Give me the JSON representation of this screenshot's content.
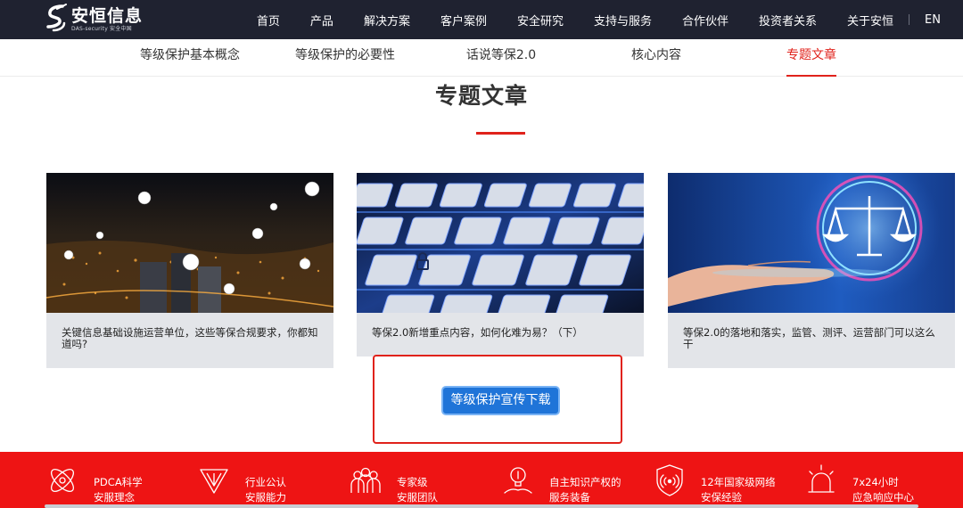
{
  "header": {
    "logo_cn": "安恒信息",
    "logo_en": "DAS-security 安全中国",
    "nav": [
      "首页",
      "产品",
      "解决方案",
      "客户案例",
      "安全研究",
      "支持与服务",
      "合作伙伴",
      "投资者关系",
      "关于安恒"
    ],
    "lang": "EN"
  },
  "subnav": {
    "items": [
      "等级保护基本概念",
      "等级保护的必要性",
      "话说等保2.0",
      "核心内容",
      "专题文章"
    ],
    "active_index": 4
  },
  "section": {
    "title": "专题文章"
  },
  "cards": [
    {
      "image": "smart-city-night-illustration",
      "text": "关键信息基础设施运营单位，这些等保合规要求，你都知道吗?"
    },
    {
      "image": "glowing-keyboard-illustration",
      "text": "等保2.0新增重点内容，如何化难为易？（下）"
    },
    {
      "image": "justice-scale-on-hand-illustration",
      "text": "等保2.0的落地和落实，监管、测评、运营部门可以这么干"
    }
  ],
  "download_button": "等级保护宣传下载",
  "features": [
    {
      "icon": "atom-icon",
      "line1": "PDCA科学",
      "line2": "安服理念"
    },
    {
      "icon": "triangle-shield-icon",
      "line1": "行业公认",
      "line2": "安服能力"
    },
    {
      "icon": "team-icon",
      "line1": "专家级",
      "line2": "安服团队"
    },
    {
      "icon": "lightbulb-hand-icon",
      "line1": "自主知识产权的",
      "line2": "服务装备"
    },
    {
      "icon": "wireless-shield-icon",
      "line1": "12年国家级网络",
      "line2": "安保经验"
    },
    {
      "icon": "alarm-icon",
      "line1": "7x24小时",
      "line2": "应急响应中心"
    }
  ],
  "colors": {
    "accent_red": "#e0221b",
    "feature_red": "#ee1414",
    "header_dark": "#1f2230",
    "button_blue": "#1f74d8"
  }
}
